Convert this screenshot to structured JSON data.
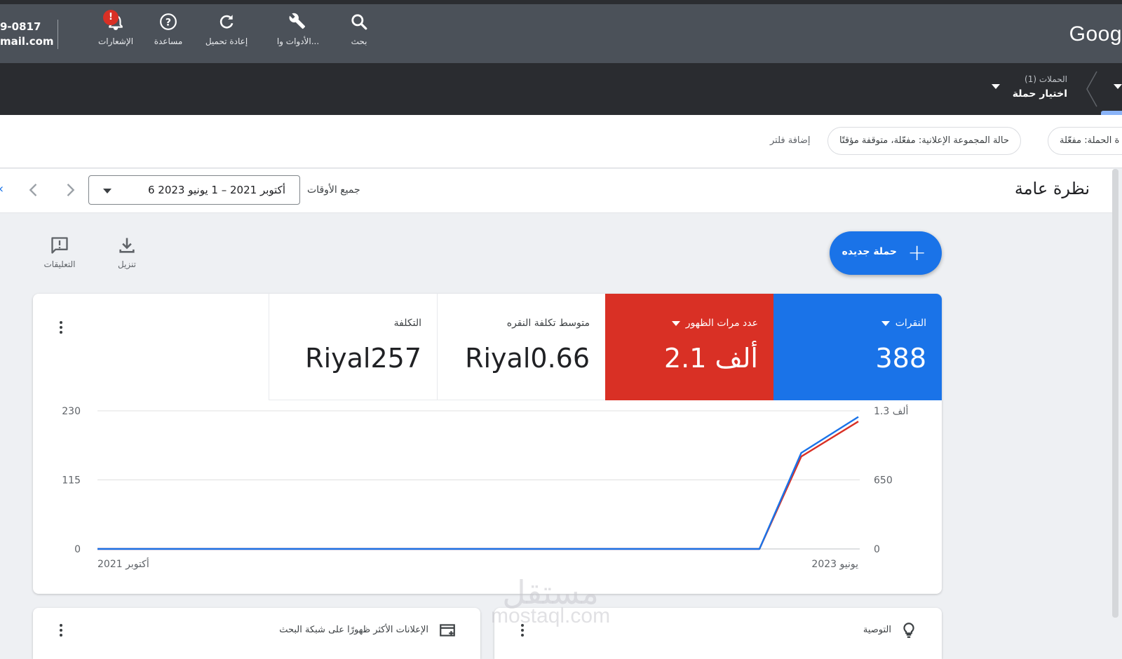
{
  "colors": {
    "topbar": "#4b5159",
    "campaign_bar": "#2a2c30",
    "clicks": "#1a73e8",
    "impressions": "#d93025",
    "accent": "#1a73e8"
  },
  "account": {
    "line1": "9-0817",
    "line2": "mail.com"
  },
  "logo": "Goog",
  "toolbar": {
    "notifications": "الإشعارات",
    "notifications_badge": "!",
    "help": "مساعدة",
    "reload": "إعادة تحميل",
    "tools": "الأدوات وا...",
    "search": "بحث"
  },
  "campaign_selector": {
    "small": "الحملات (1)",
    "main": "اختيار حملة"
  },
  "filters": {
    "chip_campaign_status": "ة الحملة: مفعّلة",
    "chip_adgroup_status": "حالة المجموعة الإعلانية: مفعّلة، متوقفة مؤقتًا",
    "add_filter": "إضافة فلتر"
  },
  "overview": {
    "title": "نظرة عامة",
    "all_time": "جميع الأوقات",
    "date_range": "6 أكتوبر 2021 – 1 يونيو 2023"
  },
  "actions": {
    "download": "تنزيل",
    "feedback": "التعليقات",
    "new_campaign": "حملة جديده"
  },
  "metrics": {
    "clicks": {
      "label": "النقرات",
      "value": "388"
    },
    "impressions": {
      "label": "عدد مرات الظهور",
      "value": "2.1 ألف"
    },
    "avg_cpc": {
      "label": "متوسط تكلفة النقره",
      "value": "Riyal0.66"
    },
    "cost": {
      "label": "التكلفة",
      "value": "Riyal257"
    }
  },
  "chart_data": {
    "type": "line",
    "x_labels": [
      "أكتوبر 2021",
      "يونيو 2023"
    ],
    "y_left_ticks": [
      "230",
      "115",
      "0"
    ],
    "y_right_ticks": [
      "1.3 ألف",
      "650",
      "0"
    ],
    "ylim_left": [
      0,
      230
    ],
    "ylim_right": [
      0,
      1300
    ],
    "x": [
      0,
      0.87,
      0.925,
      1
    ],
    "series": [
      {
        "name": "النقرات",
        "axis": "left",
        "color": "#1a73e8",
        "values": [
          0,
          0,
          160,
          220
        ]
      },
      {
        "name": "عدد مرات الظهور",
        "axis": "right",
        "color": "#d93025",
        "values": [
          0,
          0,
          870,
          1200
        ]
      }
    ]
  },
  "bottom_cards": {
    "top_ads": "الإعلانات الأكثر ظهورًا على شبكة البحث",
    "recommendation": "التوصية"
  },
  "watermark": {
    "arabic": "مستقل",
    "latin": "mostaql.com"
  }
}
